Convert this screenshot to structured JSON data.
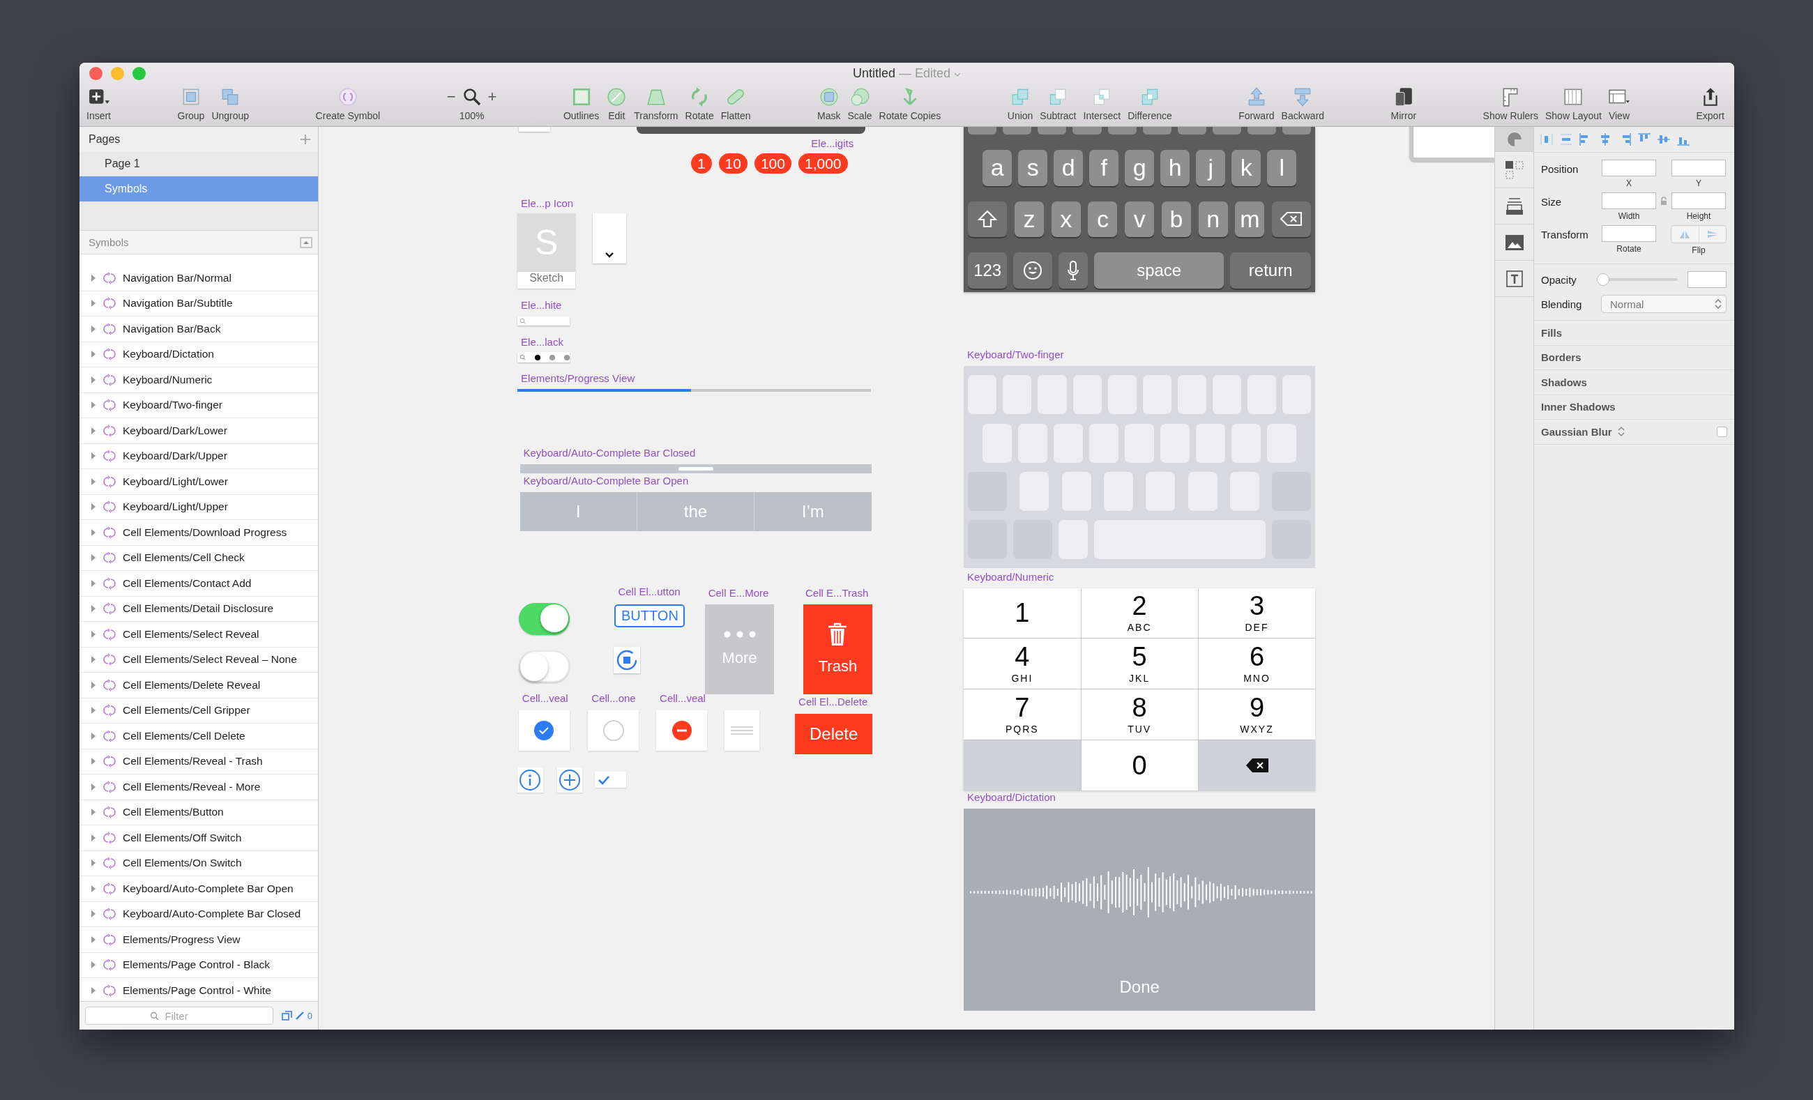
{
  "window": {
    "title": "Untitled",
    "subtitle": "— Edited"
  },
  "toolbar": {
    "groups": [
      [
        {
          "kind": "tool",
          "label": "Insert"
        }
      ],
      [
        {
          "kind": "tool",
          "label": "Group"
        },
        {
          "kind": "tool",
          "label": "Ungroup"
        }
      ],
      [
        {
          "kind": "tool",
          "label": "Create Symbol"
        }
      ],
      [
        {
          "kind": "zoom",
          "label": "100%",
          "minus": "−",
          "plus": "+"
        }
      ],
      [
        {
          "kind": "tool",
          "label": "Outlines"
        },
        {
          "kind": "tool",
          "label": "Edit"
        },
        {
          "kind": "tool",
          "label": "Transform"
        },
        {
          "kind": "tool",
          "label": "Rotate"
        },
        {
          "kind": "tool",
          "label": "Flatten"
        }
      ],
      [
        {
          "kind": "tool",
          "label": "Mask"
        },
        {
          "kind": "tool",
          "label": "Scale"
        },
        {
          "kind": "tool",
          "label": "Rotate Copies"
        }
      ],
      [
        {
          "kind": "tool",
          "label": "Union"
        },
        {
          "kind": "tool",
          "label": "Subtract"
        },
        {
          "kind": "tool",
          "label": "Intersect"
        },
        {
          "kind": "tool",
          "label": "Difference"
        }
      ],
      [
        {
          "kind": "tool",
          "label": "Forward"
        },
        {
          "kind": "tool",
          "label": "Backward"
        }
      ],
      [
        {
          "kind": "tool",
          "label": "Mirror"
        }
      ],
      [
        {
          "kind": "tool",
          "label": "Show Rulers"
        },
        {
          "kind": "tool",
          "label": "Show Layout"
        },
        {
          "kind": "tool",
          "label": "View"
        }
      ],
      [
        {
          "kind": "tool",
          "label": "Export"
        }
      ]
    ]
  },
  "pages": {
    "title": "Pages",
    "items": [
      {
        "label": "Page 1",
        "selected": false
      },
      {
        "label": "Symbols",
        "selected": true
      }
    ]
  },
  "symbols": {
    "title": "Symbols",
    "items": [
      {
        "label": "Navigation Bar/Normal"
      },
      {
        "label": "Navigation Bar/Subtitle"
      },
      {
        "label": "Navigation Bar/Back"
      },
      {
        "label": "Keyboard/Dictation"
      },
      {
        "label": "Keyboard/Numeric"
      },
      {
        "label": "Keyboard/Two-finger"
      },
      {
        "label": "Keyboard/Dark/Lower"
      },
      {
        "label": "Keyboard/Dark/Upper"
      },
      {
        "label": "Keyboard/Light/Lower"
      },
      {
        "label": "Keyboard/Light/Upper"
      },
      {
        "label": "Cell Elements/Download Progress"
      },
      {
        "label": "Cell Elements/Cell Check"
      },
      {
        "label": "Cell Elements/Contact Add"
      },
      {
        "label": "Cell Elements/Detail Disclosure"
      },
      {
        "label": "Cell Elements/Select Reveal"
      },
      {
        "label": "Cell Elements/Select Reveal – None"
      },
      {
        "label": "Cell Elements/Delete Reveal"
      },
      {
        "label": "Cell Elements/Cell Gripper"
      },
      {
        "label": "Cell Elements/Cell Delete"
      },
      {
        "label": "Cell Elements/Reveal - Trash"
      },
      {
        "label": "Cell Elements/Reveal - More"
      },
      {
        "label": "Cell Elements/Button"
      },
      {
        "label": "Cell Elements/Off Switch"
      },
      {
        "label": "Cell Elements/On Switch"
      },
      {
        "label": "Keyboard/Auto-Complete Bar Open"
      },
      {
        "label": "Keyboard/Auto-Complete Bar Closed"
      },
      {
        "label": "Elements/Progress View"
      },
      {
        "label": "Elements/Page Control - Black"
      },
      {
        "label": "Elements/Page Control - White"
      }
    ]
  },
  "filter": {
    "placeholder": "Filter",
    "count": "0"
  },
  "canvas": {
    "badges": {
      "label": "Ele...igits",
      "items": [
        "1",
        "10",
        "100",
        "1,000"
      ]
    },
    "app_icon": {
      "label": "Ele...p Icon",
      "letter": "S",
      "name": "Sketch"
    },
    "search_white": {
      "label": "Ele...hite"
    },
    "page_control": {
      "label": "Ele...lack",
      "dots": [
        {
          "selected": true
        },
        {
          "selected": false
        },
        {
          "selected": false
        }
      ]
    },
    "progress": {
      "label": "Elements/Progress View",
      "level": 0.49
    },
    "autocomplete_closed": {
      "label": "Keyboard/Auto-Complete Bar Closed"
    },
    "autocomplete_open": {
      "label": "Keyboard/Auto-Complete Bar Open",
      "suggestions": [
        "I",
        "the",
        "I’m"
      ]
    },
    "switches": [
      {
        "on": true
      },
      {
        "on": false
      }
    ],
    "button_cell": {
      "label": "Cell El...utton",
      "text": "BUTTON"
    },
    "more": {
      "label": "Cell E...More",
      "text": "More"
    },
    "trash": {
      "label": "Cell E...Trash",
      "text": "Trash"
    },
    "reveal_cells": [
      {
        "label": "Cell...veal",
        "kind": "check"
      },
      {
        "label": "Cell...one",
        "kind": "empty"
      },
      {
        "label": "Cell...veal",
        "kind": "delete"
      },
      {
        "kind": "gripper"
      }
    ],
    "delete": {
      "label": "Cell El...Delete",
      "text": "Delete"
    },
    "keyboard_dark": {
      "letter_rows": [
        [
          {
            "kind": "letter",
            "text": "a"
          },
          {
            "kind": "letter",
            "text": "s"
          },
          {
            "kind": "letter",
            "text": "d"
          },
          {
            "kind": "letter",
            "text": "f"
          },
          {
            "kind": "letter",
            "text": "g"
          },
          {
            "kind": "letter",
            "text": "h"
          },
          {
            "kind": "letter",
            "text": "j"
          },
          {
            "kind": "letter",
            "text": "k"
          },
          {
            "kind": "letter",
            "text": "l"
          }
        ],
        [
          {
            "kind": "shift"
          },
          {
            "kind": "letter",
            "text": "z"
          },
          {
            "kind": "letter",
            "text": "x"
          },
          {
            "kind": "letter",
            "text": "c"
          },
          {
            "kind": "letter",
            "text": "v"
          },
          {
            "kind": "letter",
            "text": "b"
          },
          {
            "kind": "letter",
            "text": "n"
          },
          {
            "kind": "letter",
            "text": "m"
          },
          {
            "kind": "delete"
          }
        ]
      ],
      "bottom_row": [
        {
          "kind": "function",
          "text": "123"
        },
        {
          "kind": "emoji"
        },
        {
          "kind": "mic"
        },
        {
          "kind": "space",
          "text": "space"
        },
        {
          "kind": "return",
          "text": "return"
        }
      ]
    },
    "two_finger": {
      "label": "Keyboard/Two-finger"
    },
    "numeric": {
      "label": "Keyboard/Numeric",
      "keys": [
        {
          "kind": "digit",
          "digit": "1"
        },
        {
          "kind": "digit",
          "digit": "2",
          "letters": "ABC"
        },
        {
          "kind": "digit",
          "digit": "3",
          "letters": "DEF"
        },
        {
          "kind": "digit",
          "digit": "4",
          "letters": "GHI"
        },
        {
          "kind": "digit",
          "digit": "5",
          "letters": "JKL"
        },
        {
          "kind": "digit",
          "digit": "6",
          "letters": "MNO"
        },
        {
          "kind": "digit",
          "digit": "7",
          "letters": "PQRS"
        },
        {
          "kind": "digit",
          "digit": "8",
          "letters": "TUV"
        },
        {
          "kind": "digit",
          "digit": "9",
          "letters": "WXYZ"
        },
        {
          "kind": "blank"
        },
        {
          "kind": "digit",
          "digit": "0"
        },
        {
          "kind": "delete"
        }
      ]
    },
    "dictation": {
      "label": "Keyboard/Dictation",
      "done": "Done"
    }
  },
  "inspector": {
    "tabs": [
      {
        "selected": true
      },
      {
        "selected": false
      },
      {
        "selected": false
      },
      {
        "selected": false
      },
      {
        "selected": false
      }
    ],
    "position": {
      "label": "Position",
      "fields": [
        {
          "caption": "X"
        },
        {
          "caption": "Y"
        }
      ]
    },
    "size": {
      "label": "Size",
      "fields": [
        {
          "caption": "Width"
        },
        {
          "caption": "Height"
        }
      ]
    },
    "transform": {
      "label": "Transform",
      "rotate": "Rotate",
      "flip": "Flip"
    },
    "opacity": {
      "label": "Opacity",
      "level": 0
    },
    "blending": {
      "label": "Blending",
      "value": "Normal"
    },
    "sections": [
      {
        "kind": "section",
        "label": "Fills"
      },
      {
        "kind": "section",
        "label": "Borders"
      },
      {
        "kind": "section",
        "label": "Shadows"
      },
      {
        "kind": "section",
        "label": "Inner Shadows"
      },
      {
        "kind": "toggle",
        "label": "Gaussian Blur",
        "checked": false
      }
    ]
  }
}
